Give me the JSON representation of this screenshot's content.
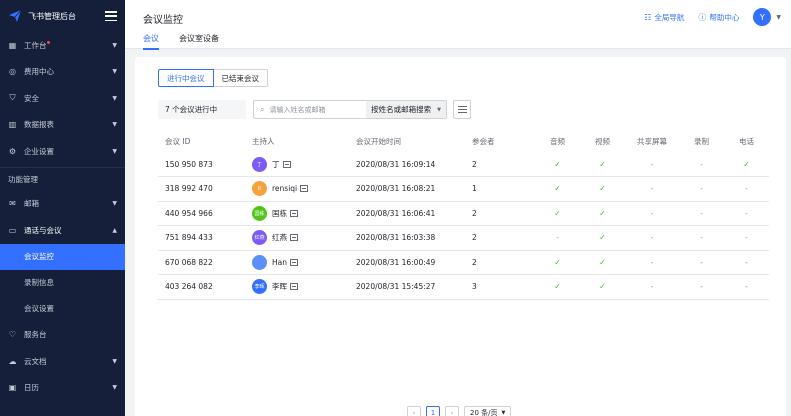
{
  "brand": {
    "title": "飞书管理后台"
  },
  "sidebar": {
    "items": [
      {
        "label": "工作台",
        "icon": "grid-icon",
        "dot": true
      },
      {
        "label": "费用中心",
        "icon": "coin-icon"
      },
      {
        "label": "安全",
        "icon": "shield-icon"
      },
      {
        "label": "数据报表",
        "icon": "chart-icon"
      },
      {
        "label": "企业设置",
        "icon": "gear-icon"
      }
    ],
    "section_label": "功能管理",
    "feature_items": [
      {
        "label": "邮箱",
        "icon": "mail-icon"
      },
      {
        "label": "通话与会议",
        "icon": "video-icon"
      }
    ],
    "sub_items": [
      {
        "label": "会议监控",
        "active": true
      },
      {
        "label": "录制信息"
      },
      {
        "label": "会议设置"
      }
    ],
    "bottom_items": [
      {
        "label": "服务台",
        "icon": "heart-icon"
      },
      {
        "label": "云文档",
        "icon": "cloud-icon"
      },
      {
        "label": "日历",
        "icon": "calendar-icon"
      }
    ]
  },
  "header": {
    "title": "会议监控",
    "tabs": [
      "会议",
      "会议室设备"
    ],
    "nav_link": "全局导航",
    "help_link": "帮助中心",
    "avatar_letter": "Y"
  },
  "filters": {
    "segments": [
      "进行中会议",
      "已结束会议"
    ],
    "count_text": "7 个会议进行中",
    "search_placeholder": "请输入姓名或邮箱",
    "search_type": "按姓名或邮箱搜索"
  },
  "table": {
    "columns": [
      "会议 ID",
      "主持人",
      "会议开始时间",
      "参会者",
      "音频",
      "视频",
      "共享屏幕",
      "录制",
      "电话"
    ],
    "rows": [
      {
        "id": "150 950 873",
        "host": "丁",
        "avatar_text": "丁",
        "avatar_color": "#7c5cf5",
        "start": "2020/08/31 16:09:14",
        "participants": "2",
        "audio": "✓",
        "video": "✓",
        "share": "-",
        "record": "-",
        "phone": "✓"
      },
      {
        "id": "318 992 470",
        "host": "rensiqi",
        "avatar_text": "R",
        "avatar_color": "#f5a23a",
        "start": "2020/08/31 16:08:21",
        "participants": "1",
        "audio": "✓",
        "video": "✓",
        "share": "-",
        "record": "-",
        "phone": "-"
      },
      {
        "id": "440 954 966",
        "host": "国栋",
        "avatar_text": "国栋",
        "avatar_color": "#52c41a",
        "start": "2020/08/31 16:06:41",
        "participants": "2",
        "audio": "✓",
        "video": "✓",
        "share": "-",
        "record": "-",
        "phone": "-"
      },
      {
        "id": "751 894 433",
        "host": "红燕",
        "avatar_text": "红燕",
        "avatar_color": "#7c5cf5",
        "start": "2020/08/31 16:03:38",
        "participants": "2",
        "audio": "-",
        "video": "✓",
        "share": "-",
        "record": "-",
        "phone": "-"
      },
      {
        "id": "670 068 822",
        "host": "Han",
        "avatar_text": "",
        "avatar_color": "#5b8ff9",
        "start": "2020/08/31 16:00:49",
        "participants": "2",
        "audio": "✓",
        "video": "✓",
        "share": "-",
        "record": "-",
        "phone": "-"
      },
      {
        "id": "403 264 082",
        "host": "李晖",
        "avatar_text": "李晖",
        "avatar_color": "#3370ff",
        "start": "2020/08/31 15:45:27",
        "participants": "3",
        "audio": "✓",
        "video": "✓",
        "share": "-",
        "record": "-",
        "phone": "-"
      }
    ]
  },
  "pagination": {
    "current": "1",
    "page_size": "20 条/页"
  }
}
